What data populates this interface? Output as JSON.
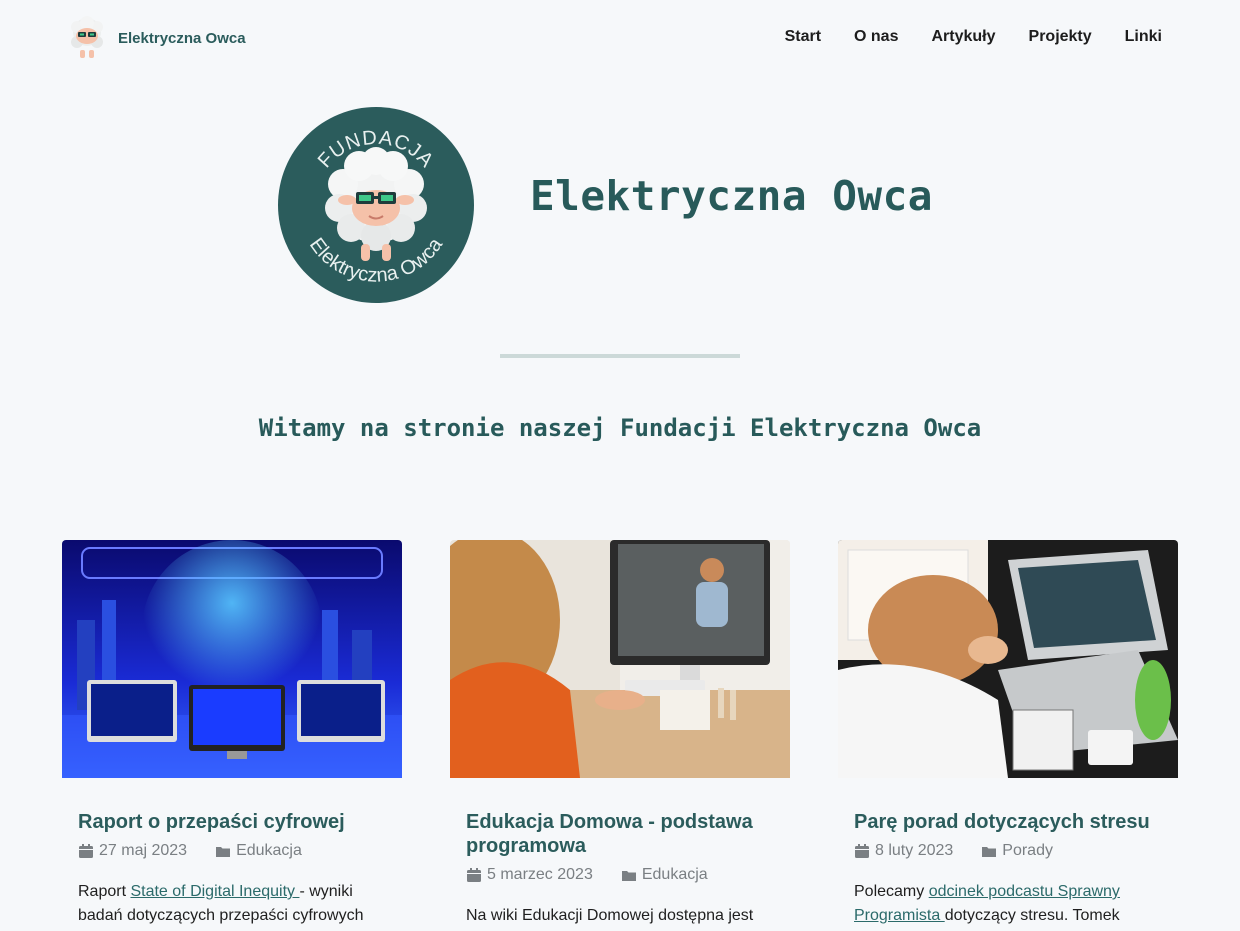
{
  "brand": {
    "name": "Elektryczna Owca",
    "logo_icon": "sheep-logo-icon"
  },
  "nav": {
    "items": [
      {
        "label": "Start"
      },
      {
        "label": "O nas"
      },
      {
        "label": "Artykuły"
      },
      {
        "label": "Projekty"
      },
      {
        "label": "Linki"
      }
    ]
  },
  "hero": {
    "logo_top_text": "FUNDACJA",
    "logo_bottom_text": "Elektryczna Owca",
    "title": "Elektryczna Owca",
    "welcome": "Witamy na stronie naszej Fundacji Elektryczna Owca"
  },
  "colors": {
    "accent": "#285a5a",
    "logo_circle": "#2b5c5c",
    "background": "#f6f8fa"
  },
  "cards": [
    {
      "title": "Raport o przepaści cyfrowej",
      "date": "27 maj 2023",
      "category": "Edukacja",
      "text_before": "Raport ",
      "link": "State of Digital Inequity ",
      "text_after": "- wyniki badań dotyczących przepaści cyfrowych",
      "image": "digital-city-monitors-image"
    },
    {
      "title": "Edukacja Domowa - podstawa programowa",
      "date": "5 marzec 2023",
      "category": "Edukacja",
      "text_before": "Na wiki Edukacji Domowej dostępna jest",
      "link": "",
      "text_after": "",
      "image": "home-education-video-call-image"
    },
    {
      "title": "Parę porad dotyczących stresu",
      "date": "8 luty 2023",
      "category": "Porady",
      "text_before": "Polecamy ",
      "link": "odcinek podcastu Sprawny Programista ",
      "text_after": "dotyczący stresu. Tomek",
      "image": "stressed-person-laptop-image"
    }
  ]
}
